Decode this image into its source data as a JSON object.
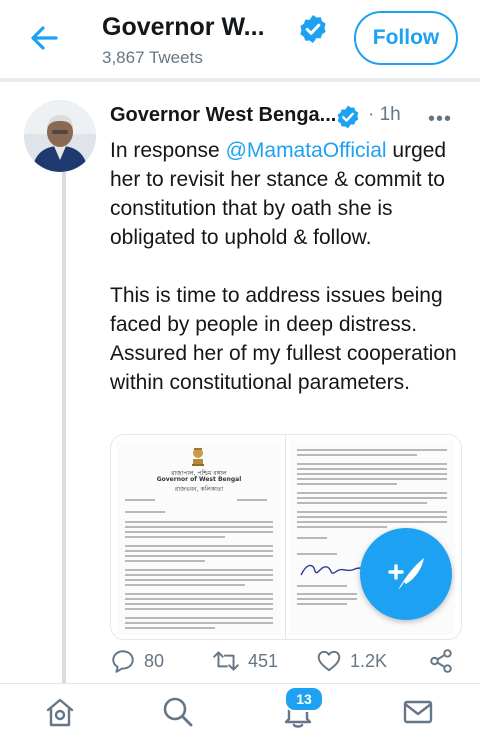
{
  "header": {
    "title": "Governor W...",
    "tweet_count": "3,867 Tweets",
    "follow_label": "Follow"
  },
  "tweet": {
    "author_name": "Governor West Benga...",
    "separator": "·",
    "time": "1h",
    "more": "•••",
    "text_intro": "In response ",
    "mention": "@MamataOfficial",
    "text_rest": " urged her to revisit her stance & commit to constitution that by oath she is obligated to uphold & follow.",
    "text_para2": "This is time to address issues being faced by people in deep distress. Assured her of my fullest cooperation within constitutional parameters.",
    "media": {
      "letterhead_line1": "রাজ্যপাল, পশ্চিম বঙ্গাল",
      "letterhead_line2": "Governor of West Bengal",
      "letterhead_line3": "রাজভবন, কলিকাতা"
    },
    "actions": {
      "replies": "80",
      "retweets": "451",
      "likes": "1.2K"
    }
  },
  "fab": {
    "icon": "compose-tweet-icon"
  },
  "bottom_nav": {
    "items": [
      "home-icon",
      "search-icon",
      "notifications-icon",
      "messages-icon"
    ],
    "notifications_badge": "13"
  },
  "colors": {
    "accent": "#1da1f2",
    "secondary_text": "#657786",
    "border": "#e1e8ed"
  }
}
